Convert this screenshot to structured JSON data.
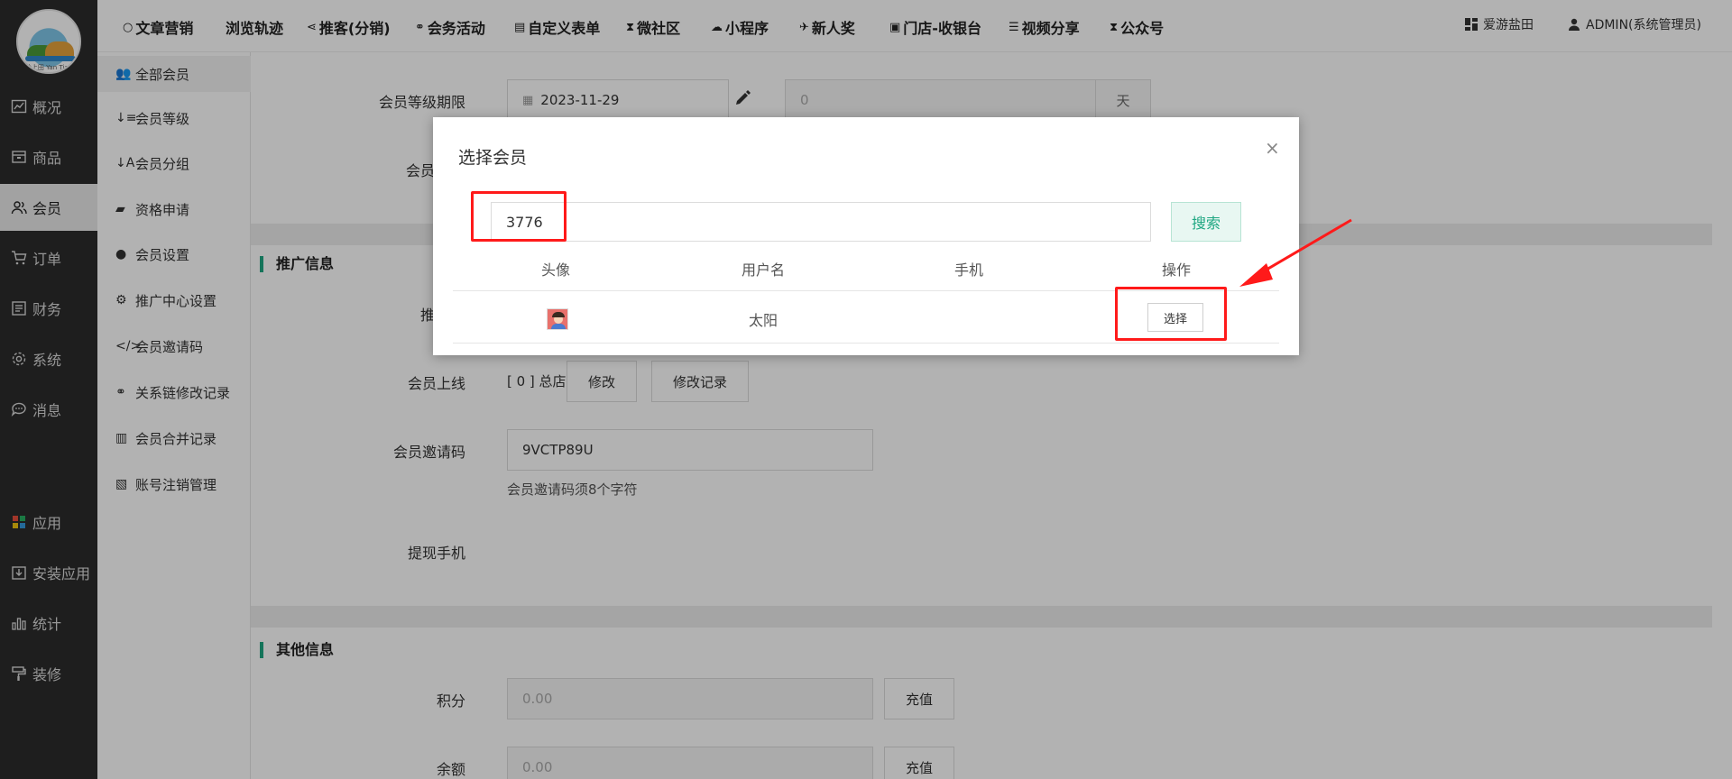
{
  "logo": {
    "text": "盐上田 Yan Tian"
  },
  "sidebar": {
    "items": [
      {
        "label": "概况",
        "icon": "chart-icon"
      },
      {
        "label": "商品",
        "icon": "box-icon"
      },
      {
        "label": "会员",
        "icon": "users-icon",
        "active": true
      },
      {
        "label": "订单",
        "icon": "cart-icon"
      },
      {
        "label": "财务",
        "icon": "ledger-icon"
      },
      {
        "label": "系统",
        "icon": "gear-icon"
      },
      {
        "label": "消息",
        "icon": "chat-icon"
      },
      {
        "label": "应用",
        "icon": "apps-icon"
      },
      {
        "label": "安装应用",
        "icon": "install-icon"
      },
      {
        "label": "统计",
        "icon": "stats-icon"
      },
      {
        "label": "装修",
        "icon": "brush-icon"
      }
    ]
  },
  "topnav": {
    "items": [
      {
        "label": "文章营销",
        "icon": "○"
      },
      {
        "label": "浏览轨迹",
        "icon": ""
      },
      {
        "label": "推客(分销)",
        "icon": "⋖"
      },
      {
        "label": "会务活动",
        "icon": "⚭"
      },
      {
        "label": "自定义表单",
        "icon": "▤"
      },
      {
        "label": "微社区",
        "icon": "⧗"
      },
      {
        "label": "小程序",
        "icon": "☁"
      },
      {
        "label": "新人奖",
        "icon": "✈"
      },
      {
        "label": "门店-收银台",
        "icon": "▣"
      },
      {
        "label": "视频分享",
        "icon": "☰"
      },
      {
        "label": "公众号",
        "icon": "⧗"
      }
    ],
    "shop": "爱游盐田",
    "user": "ADMIN(系统管理员)"
  },
  "submenu": {
    "items": [
      {
        "label": "全部会员",
        "icon": "👥",
        "active": true
      },
      {
        "label": "会员等级",
        "icon": "↓≡"
      },
      {
        "label": "会员分组",
        "icon": "↓A"
      },
      {
        "label": "资格申请",
        "icon": "▰"
      },
      {
        "label": "会员设置",
        "icon": "●"
      },
      {
        "label": "推广中心设置",
        "icon": "⚙"
      },
      {
        "label": "会员邀请码",
        "icon": "</>"
      },
      {
        "label": "关系链修改记录",
        "icon": "⚭"
      },
      {
        "label": "会员合并记录",
        "icon": "▥"
      },
      {
        "label": "账号注销管理",
        "icon": "▧"
      }
    ]
  },
  "form": {
    "level_expiry_label": "会员等级期限",
    "level_expiry_date": "2023-11-29",
    "level_expiry_days_value": "0",
    "level_expiry_days_unit": "天",
    "partial_label_1": "会员",
    "promo_section": "推广信息",
    "partial_label_2": "推",
    "upline_label": "会员上线",
    "upline_value": "[ 0 ] 总店",
    "upline_edit": "修改",
    "upline_history": "修改记录",
    "invite_code_label": "会员邀请码",
    "invite_code_value": "9VCTP89U",
    "invite_code_hint": "会员邀请码须8个字符",
    "withdraw_phone_label": "提现手机",
    "other_section": "其他信息",
    "points_label": "积分",
    "points_value": "0.00",
    "points_recharge": "充值",
    "balance_label": "余额",
    "balance_value": "0.00",
    "balance_recharge": "充值"
  },
  "modal": {
    "title": "选择会员",
    "close": "×",
    "search_value": "3776",
    "search_button": "搜索",
    "columns": [
      "头像",
      "用户名",
      "手机",
      "操作"
    ],
    "rows": [
      {
        "username": "太阳",
        "phone": "",
        "action": "选择"
      }
    ]
  },
  "colors": {
    "accent": "#1fa782",
    "sidebar_bg": "#2c2c2c",
    "annotation": "#ff1a1a"
  }
}
